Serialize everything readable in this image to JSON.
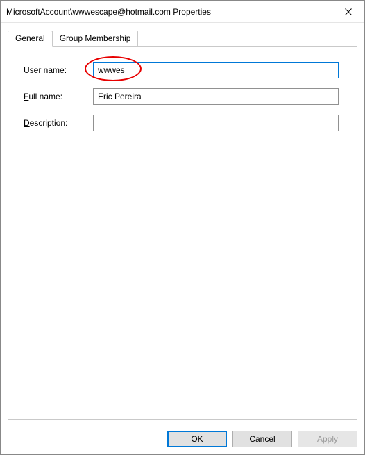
{
  "window": {
    "title": "MicrosoftAccount\\wwwescape@hotmail.com Properties"
  },
  "tabs": {
    "general": "General",
    "group_membership": "Group Membership"
  },
  "form": {
    "user_name": {
      "label_pre": "U",
      "label_post": "ser name:",
      "value": "wwwes"
    },
    "full_name": {
      "label_pre": "F",
      "label_post": "ull name:",
      "value": "Eric Pereira"
    },
    "description": {
      "label_pre": "D",
      "label_post": "escription:",
      "value": ""
    }
  },
  "buttons": {
    "ok": "OK",
    "cancel": "Cancel",
    "apply": "Apply"
  }
}
